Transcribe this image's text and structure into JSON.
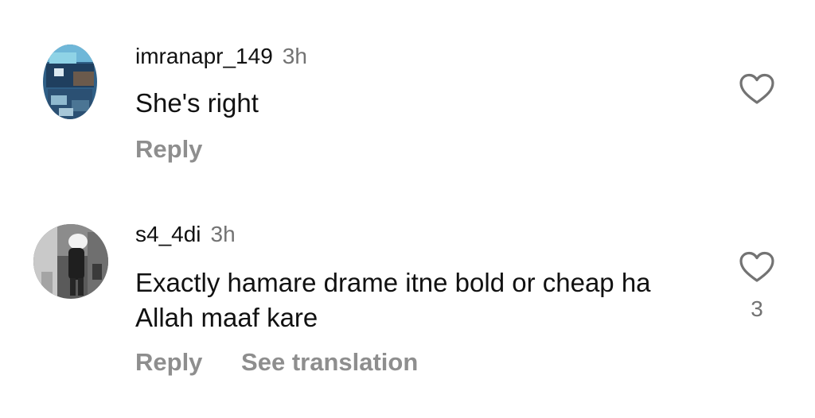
{
  "comments": [
    {
      "username": "imranapr_149",
      "time": "3h",
      "text": "She's right",
      "reply_label": "Reply",
      "like_icon": "heart-outline-icon",
      "like_count": ""
    },
    {
      "username": "s4_4di",
      "time": "3h",
      "text": "Exactly hamare drame itne bold or cheap ha Allah maaf kare",
      "reply_label": "Reply",
      "translation_label": "See translation",
      "like_icon": "heart-outline-icon",
      "like_count": "3"
    }
  ]
}
